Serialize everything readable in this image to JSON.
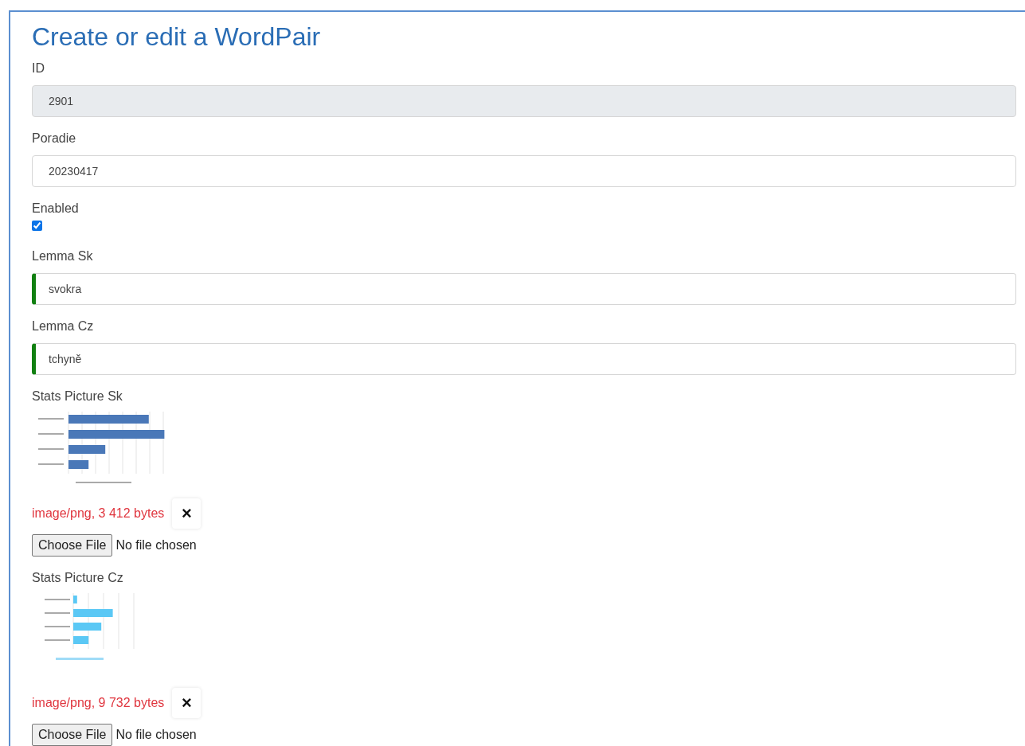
{
  "title": "Create or edit a WordPair",
  "fields": [
    {
      "kind": "text",
      "label": "ID",
      "value": "2901",
      "disabled": true,
      "valid": false
    },
    {
      "kind": "text",
      "label": "Poradie",
      "value": "20230417",
      "disabled": false,
      "valid": false
    },
    {
      "kind": "checkbox",
      "label": "Enabled",
      "checked": true
    },
    {
      "kind": "text",
      "label": "Lemma Sk",
      "value": "svokra",
      "disabled": false,
      "valid": true
    },
    {
      "kind": "text",
      "label": "Lemma Cz",
      "value": "tchyně",
      "disabled": false,
      "valid": true
    },
    {
      "label": "Stats Picture Sk",
      "info": "image/png, 3 412 bytes",
      "remove": "×",
      "file_button": "Choose File",
      "file_status": "No file chosen"
    },
    {
      "label": "Stats Picture Cz",
      "info": "image/png, 9 732 bytes",
      "remove": "×",
      "file_button": "Choose File",
      "file_status": "No file chosen"
    }
  ]
}
